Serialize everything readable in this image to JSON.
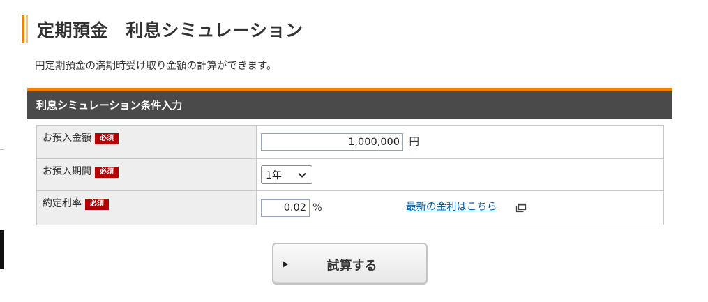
{
  "page": {
    "title": "定期預金　利息シミュレーション",
    "lead": "円定期預金の満期時受け取り金額の計算ができます。"
  },
  "section": {
    "title": "利息シミュレーション条件入力"
  },
  "colors": {
    "accent": "#f08300",
    "header_bg": "#4a4a4a",
    "required_badge": "#b40000",
    "link": "#0a5a9c"
  },
  "form": {
    "required_badge": "必須",
    "amount": {
      "label": "お預入金額",
      "value": "1,000,000",
      "unit": "円"
    },
    "period": {
      "label": "お預入期間",
      "selected": "1年",
      "icon": "chevron-down-icon"
    },
    "rate": {
      "label": "約定利率",
      "value": "0.02",
      "unit": "%",
      "link_text": "最新の金利はこちら",
      "link_icon": "external-window-icon"
    }
  },
  "actions": {
    "calculate_label": "試算する",
    "calculate_icon": "play-triangle-icon"
  }
}
